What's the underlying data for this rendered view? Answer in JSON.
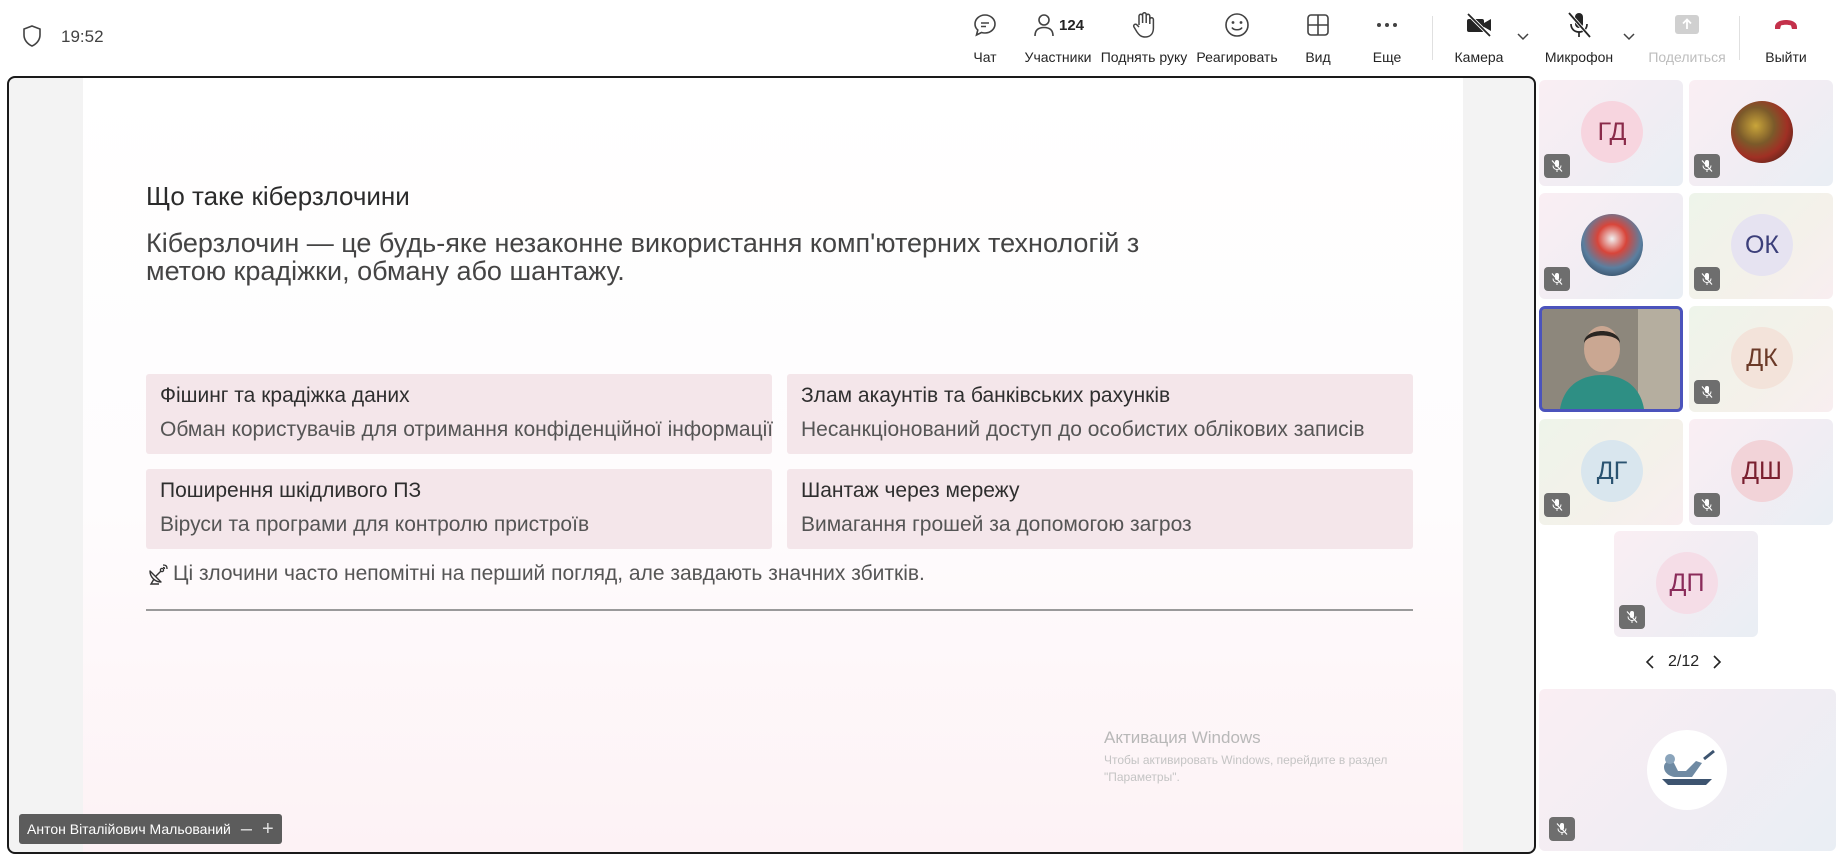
{
  "header": {
    "time": "19:52",
    "participants_count": "124",
    "buttons": {
      "chat": "Чат",
      "participants": "Участники",
      "raise_hand": "Поднять руку",
      "react": "Реагировать",
      "view": "Вид",
      "more": "Еще",
      "camera": "Камера",
      "mic": "Микрофон",
      "share": "Поделиться",
      "leave": "Выйти"
    }
  },
  "slide": {
    "title": "Що таке кіберзлочини",
    "subtitle": "Кіберзлочин — це будь-яке незаконне використання комп'ютерних технологій з метою крадіжки, обману або шантажу.",
    "cards": [
      {
        "heading": "Фішинг та крадіжка даних",
        "body": "Обман користувачів для отримання конфіденційної інформації"
      },
      {
        "heading": "Злам акаунтів та банківських рахунків",
        "body": "Несанкціонований доступ до особистих облікових записів"
      },
      {
        "heading": "Поширення шкідливого ПЗ",
        "body": "Віруси та програми для контролю пристроїв"
      },
      {
        "heading": "Шантаж через мережу",
        "body": "Вимагання грошей за допомогою загроз"
      }
    ],
    "note": "Ці злочини часто непомітні на перший погляд, але завдають значних збитків.",
    "watermark_title": "Активация Windows",
    "watermark_text": "Чтобы активировать Windows, перейдите в раздел \"Параметры\"."
  },
  "presenter": {
    "name": "Антон Віталійович Мальований"
  },
  "gallery": {
    "tiles": [
      {
        "initials": "ГД"
      },
      {
        "initials": ""
      },
      {
        "initials": ""
      },
      {
        "initials": "ОК"
      },
      {
        "initials": ""
      },
      {
        "initials": "ДК"
      },
      {
        "initials": "ДГ"
      },
      {
        "initials": "ДШ"
      },
      {
        "initials": "ДП"
      }
    ],
    "page": "2/12"
  },
  "colors": {
    "accent": "#4b53bc",
    "leave": "#c4314b",
    "card": "#f4e6ea"
  }
}
